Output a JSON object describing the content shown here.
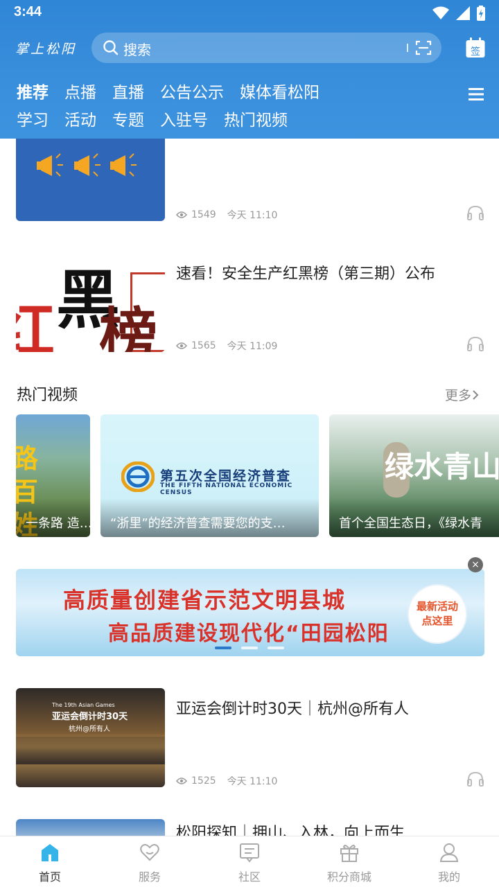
{
  "status": {
    "time": "3:44"
  },
  "header": {
    "logo_text": "掌上松阳",
    "search_placeholder": "搜索",
    "sign_label": "签",
    "tabs_row1": [
      "推荐",
      "点播",
      "直播",
      "公告公示",
      "媒体看松阳"
    ],
    "tabs_row2": [
      "学习",
      "活动",
      "专题",
      "入驻号",
      "热门视频"
    ]
  },
  "news": [
    {
      "title": "",
      "views": "1549",
      "time": "今天 11:10"
    },
    {
      "title": "速看！安全生产红黑榜（第三期）公布",
      "views": "1565",
      "time": "今天 11:09",
      "thumb_text": [
        "黑",
        "红",
        "榜"
      ]
    },
    {
      "title": "亚运会倒计时30天｜杭州@所有人",
      "views": "1525",
      "time": "今天 11:10",
      "thumb_text": [
        "The 19th Asian Games",
        "亚运会倒计时30天",
        "杭州@所有人"
      ]
    },
    {
      "title": "松阳探知｜拥山、入林，向上而生"
    }
  ],
  "hot_videos": {
    "section_title": "热门视频",
    "more_label": "更多",
    "items": [
      {
        "caption": "一条路 造…",
        "art_text": "路 百姓"
      },
      {
        "caption": "“浙里”的经济普查需要您的支…",
        "art_text": "第五次全国经济普查",
        "art_sub": "THE FIFTH NATIONAL ECONOMIC CENSUS"
      },
      {
        "caption": "首个全国生态日，《绿水青",
        "art_text": "绿水青山"
      }
    ]
  },
  "banner": {
    "line1": "高质量创建省示范文明县城",
    "line2": "高品质建设现代化“田园松阳",
    "promo_line1": "最新活动",
    "promo_line2": "点这里",
    "close": "×"
  },
  "bottom_nav": [
    {
      "label": "首页",
      "icon": "home-icon",
      "active": true
    },
    {
      "label": "服务",
      "icon": "heart-icon"
    },
    {
      "label": "社区",
      "icon": "chat-icon"
    },
    {
      "label": "积分商城",
      "icon": "gift-icon"
    },
    {
      "label": "我的",
      "icon": "user-icon"
    }
  ],
  "colors": {
    "header": "#3a8fdc",
    "banner_text": "#d8322a",
    "promo": "#e5532a"
  }
}
